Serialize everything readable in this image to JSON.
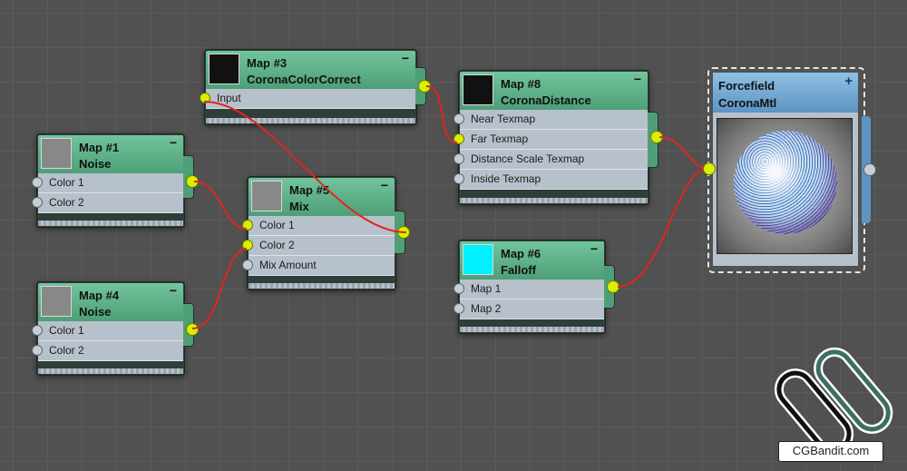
{
  "nodes": {
    "map1": {
      "title": "Map #1",
      "type": "Noise",
      "thumb": "#8a8a8a",
      "inputs": [
        "Color 1",
        "Color 2"
      ]
    },
    "map4": {
      "title": "Map #4",
      "type": "Noise",
      "thumb": "#8a8a8a",
      "inputs": [
        "Color 1",
        "Color 2"
      ]
    },
    "map3": {
      "title": "Map #3",
      "type": "CoronaColorCorrect",
      "thumb": "#111111",
      "inputs": [
        "Input"
      ]
    },
    "map5": {
      "title": "Map #5",
      "type": "Mix",
      "thumb": "#8a8a8a",
      "inputs": [
        "Color 1",
        "Color 2",
        "Mix Amount"
      ]
    },
    "map8": {
      "title": "Map #8",
      "type": "CoronaDistance",
      "thumb": "#111111",
      "inputs": [
        "Near Texmap",
        "Far Texmap",
        "Distance Scale Texmap",
        "Inside Texmap"
      ]
    },
    "map6": {
      "title": "Map #6",
      "type": "Falloff",
      "thumb": "#00f0ff",
      "inputs": [
        "Map 1",
        "Map 2"
      ]
    }
  },
  "material": {
    "name": "Forcefield",
    "type": "CoronaMtl",
    "expand_icon": "+"
  },
  "minimize_icon": "−",
  "watermark": {
    "text": "CGBandit.com"
  },
  "colors": {
    "node_header": "#5fae87",
    "material_header": "#6ea4d0",
    "wire": "#e02424",
    "port_active": "#d8f000"
  }
}
